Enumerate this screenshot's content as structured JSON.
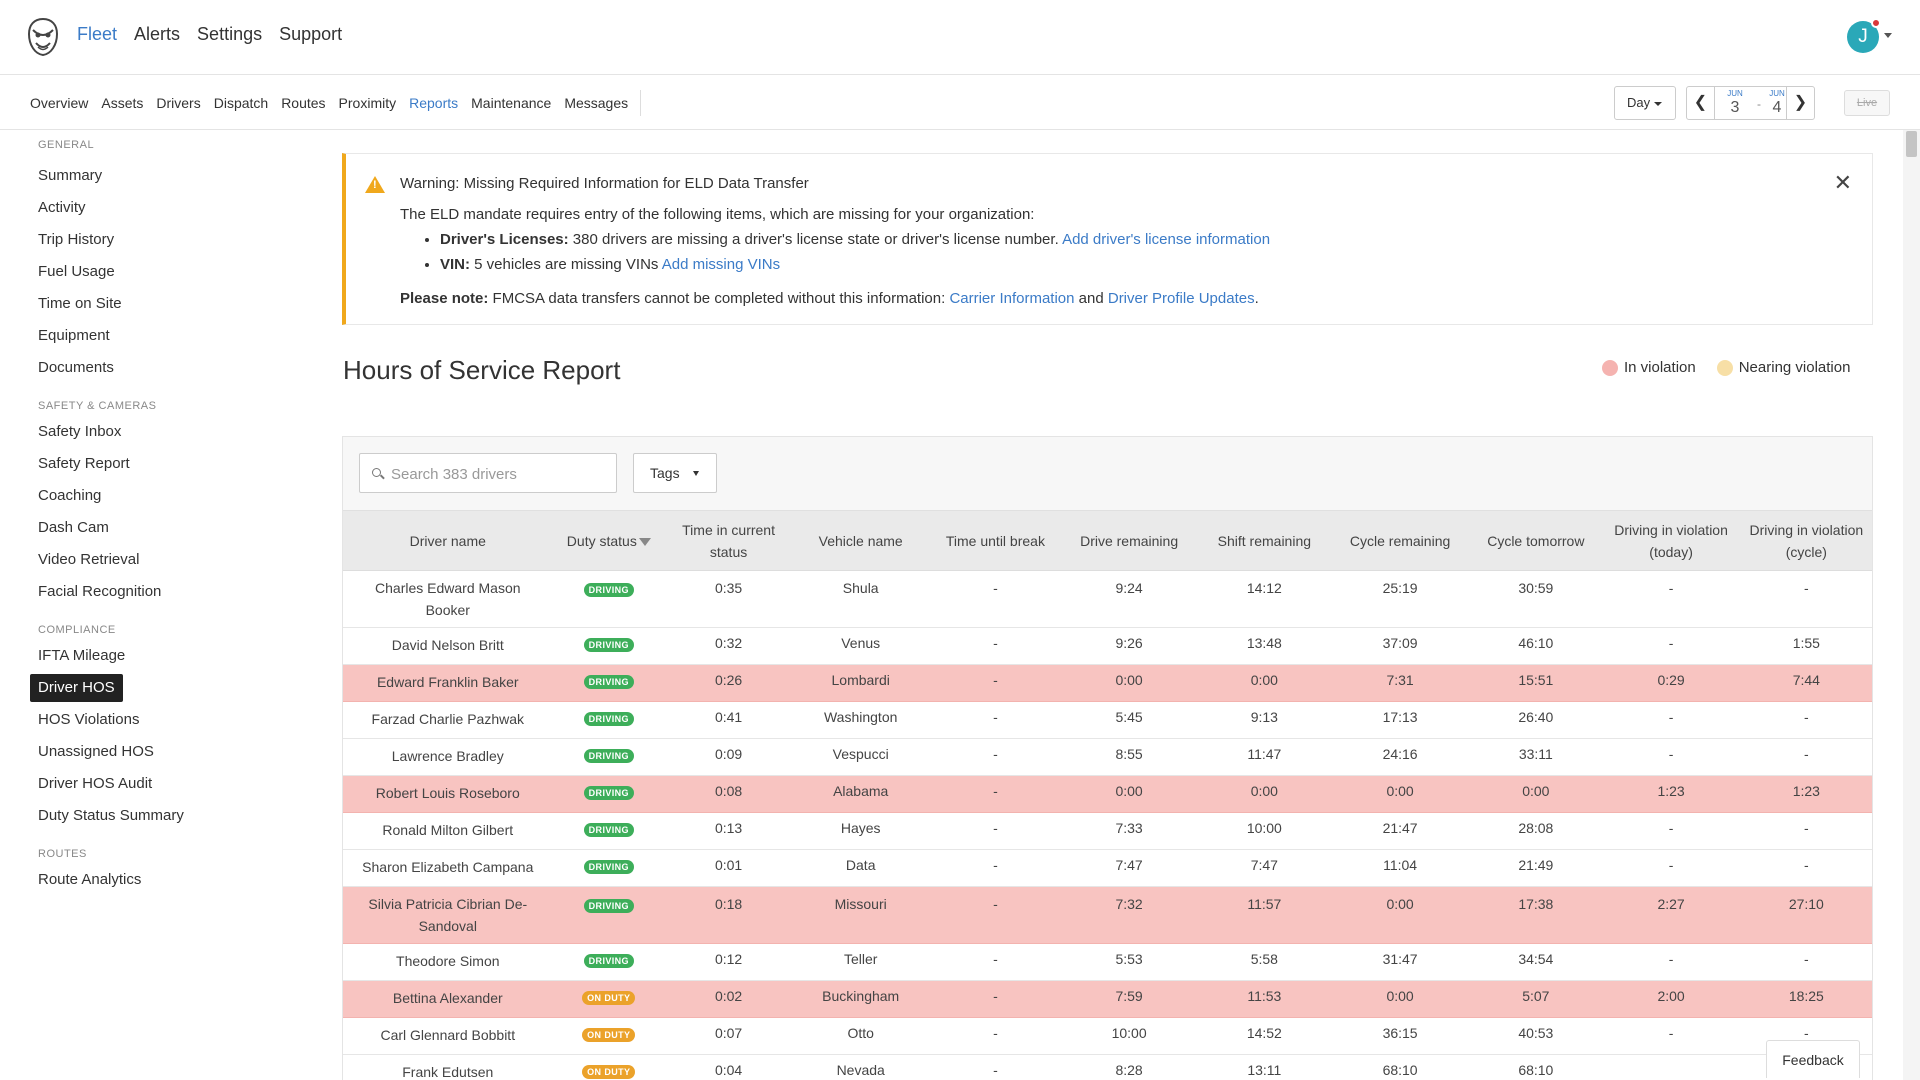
{
  "header": {
    "nav": [
      "Fleet",
      "Alerts",
      "Settings",
      "Support"
    ],
    "active_nav": "Fleet",
    "avatar_initial": "J"
  },
  "subnav": {
    "items": [
      "Overview",
      "Assets",
      "Drivers",
      "Dispatch",
      "Routes",
      "Proximity",
      "Reports",
      "Maintenance",
      "Messages"
    ],
    "active": "Reports",
    "day_label": "Day",
    "date_from": {
      "month": "JUN",
      "day": "3"
    },
    "date_to": {
      "month": "JUN",
      "day": "4"
    },
    "date_separator": "-",
    "live_label": "Live"
  },
  "sidebar": {
    "sections": [
      {
        "title": "GENERAL",
        "items": [
          "Summary",
          "Activity",
          "Trip History",
          "Fuel Usage",
          "Time on Site",
          "Equipment",
          "Documents"
        ]
      },
      {
        "title": "SAFETY & CAMERAS",
        "items": [
          "Safety Inbox",
          "Safety Report",
          "Coaching",
          "Dash Cam",
          "Video Retrieval",
          "Facial Recognition"
        ]
      },
      {
        "title": "COMPLIANCE",
        "items": [
          "IFTA Mileage",
          "Driver HOS",
          "HOS Violations",
          "Unassigned HOS",
          "Driver HOS Audit",
          "Duty Status Summary"
        ]
      },
      {
        "title": "ROUTES",
        "items": [
          "Route Analytics"
        ]
      }
    ],
    "active": "Driver HOS"
  },
  "warning": {
    "title": "Warning: Missing Required Information for ELD Data Transfer",
    "intro": "The ELD mandate requires entry of the following items, which are missing for your organization:",
    "bullet1_label": "Driver's Licenses:",
    "bullet1_text": " 380 drivers are missing a driver's license state or driver's license number. ",
    "bullet1_link": "Add driver's license information",
    "bullet2_label": "VIN:",
    "bullet2_text": " 5 vehicles are missing VINs ",
    "bullet2_link": "Add missing VINs",
    "note_label": "Please note:",
    "note_text": " FMCSA data transfers cannot be completed without this information: ",
    "note_link1": "Carrier Information",
    "note_and": " and ",
    "note_link2": "Driver Profile Updates",
    "note_end": "."
  },
  "report": {
    "title": "Hours of Service Report",
    "legend": [
      {
        "label": "In violation",
        "color": "#f5b3b0"
      },
      {
        "label": "Nearing violation",
        "color": "#f7dfa6"
      }
    ],
    "search_placeholder": "Search 383 drivers",
    "tags_label": "Tags"
  },
  "table": {
    "columns": [
      "Driver name",
      "Duty status",
      "Time in current status",
      "Vehicle name",
      "Time until break",
      "Drive remaining",
      "Shift remaining",
      "Cycle remaining",
      "Cycle tomorrow",
      "Driving in violation (today)",
      "Driving in violation (cycle)"
    ],
    "rows": [
      {
        "name": "Charles Edward Mason Booker",
        "status": "DRIVING",
        "time": "0:35",
        "vehicle": "Shula",
        "break": "-",
        "drive": "9:24",
        "shift": "14:12",
        "cycle": "25:19",
        "tomorrow": "30:59",
        "viol_today": "-",
        "viol_cycle": "-",
        "violation": false
      },
      {
        "name": "David Nelson Britt",
        "status": "DRIVING",
        "time": "0:32",
        "vehicle": "Venus",
        "break": "-",
        "drive": "9:26",
        "shift": "13:48",
        "cycle": "37:09",
        "tomorrow": "46:10",
        "viol_today": "-",
        "viol_cycle": "1:55",
        "violation": false
      },
      {
        "name": "Edward Franklin Baker",
        "status": "DRIVING",
        "time": "0:26",
        "vehicle": "Lombardi",
        "break": "-",
        "drive": "0:00",
        "shift": "0:00",
        "cycle": "7:31",
        "tomorrow": "15:51",
        "viol_today": "0:29",
        "viol_cycle": "7:44",
        "violation": true
      },
      {
        "name": "Farzad Charlie Pazhwak",
        "status": "DRIVING",
        "time": "0:41",
        "vehicle": "Washington",
        "break": "-",
        "drive": "5:45",
        "shift": "9:13",
        "cycle": "17:13",
        "tomorrow": "26:40",
        "viol_today": "-",
        "viol_cycle": "-",
        "violation": false
      },
      {
        "name": "Lawrence Bradley",
        "status": "DRIVING",
        "time": "0:09",
        "vehicle": "Vespucci",
        "break": "-",
        "drive": "8:55",
        "shift": "11:47",
        "cycle": "24:16",
        "tomorrow": "33:11",
        "viol_today": "-",
        "viol_cycle": "-",
        "violation": false
      },
      {
        "name": "Robert Louis Roseboro",
        "status": "DRIVING",
        "time": "0:08",
        "vehicle": "Alabama",
        "break": "-",
        "drive": "0:00",
        "shift": "0:00",
        "cycle": "0:00",
        "tomorrow": "0:00",
        "viol_today": "1:23",
        "viol_cycle": "1:23",
        "violation": true
      },
      {
        "name": "Ronald Milton Gilbert",
        "status": "DRIVING",
        "time": "0:13",
        "vehicle": "Hayes",
        "break": "-",
        "drive": "7:33",
        "shift": "10:00",
        "cycle": "21:47",
        "tomorrow": "28:08",
        "viol_today": "-",
        "viol_cycle": "-",
        "violation": false
      },
      {
        "name": "Sharon Elizabeth Campana",
        "status": "DRIVING",
        "time": "0:01",
        "vehicle": "Data",
        "break": "-",
        "drive": "7:47",
        "shift": "7:47",
        "cycle": "11:04",
        "tomorrow": "21:49",
        "viol_today": "-",
        "viol_cycle": "-",
        "violation": false
      },
      {
        "name": "Silvia Patricia Cibrian De-Sandoval",
        "status": "DRIVING",
        "time": "0:18",
        "vehicle": "Missouri",
        "break": "-",
        "drive": "7:32",
        "shift": "11:57",
        "cycle": "0:00",
        "tomorrow": "17:38",
        "viol_today": "2:27",
        "viol_cycle": "27:10",
        "violation": true
      },
      {
        "name": "Theodore Simon",
        "status": "DRIVING",
        "time": "0:12",
        "vehicle": "Teller",
        "break": "-",
        "drive": "5:53",
        "shift": "5:58",
        "cycle": "31:47",
        "tomorrow": "34:54",
        "viol_today": "-",
        "viol_cycle": "-",
        "violation": false
      },
      {
        "name": "Bettina Alexander",
        "status": "ON DUTY",
        "time": "0:02",
        "vehicle": "Buckingham",
        "break": "-",
        "drive": "7:59",
        "shift": "11:53",
        "cycle": "0:00",
        "tomorrow": "5:07",
        "viol_today": "2:00",
        "viol_cycle": "18:25",
        "violation": true
      },
      {
        "name": "Carl Glennard Bobbitt",
        "status": "ON DUTY",
        "time": "0:07",
        "vehicle": "Otto",
        "break": "-",
        "drive": "10:00",
        "shift": "14:52",
        "cycle": "36:15",
        "tomorrow": "40:53",
        "viol_today": "-",
        "viol_cycle": "-",
        "violation": false
      },
      {
        "name": "Frank Edutsen",
        "status": "ON DUTY",
        "time": "0:04",
        "vehicle": "Nevada",
        "break": "-",
        "drive": "8:28",
        "shift": "13:11",
        "cycle": "68:10",
        "tomorrow": "68:10",
        "viol_today": "",
        "viol_cycle": "",
        "violation": false
      }
    ]
  },
  "feedback_label": "Feedback",
  "colors": {
    "accent": "#3b7bc7",
    "violation_row": "#f8c4c1",
    "driving_badge": "#3dae5a",
    "onduty_badge": "#eba22a",
    "warning": "#f0a81c"
  }
}
